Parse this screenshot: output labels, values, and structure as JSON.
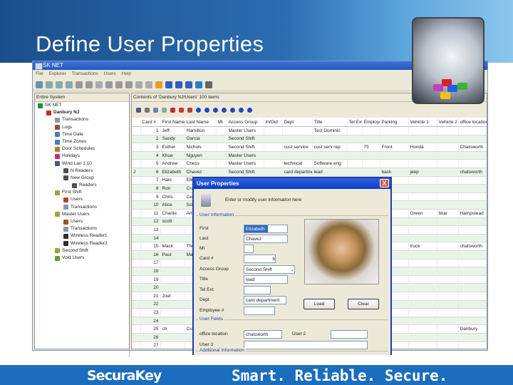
{
  "slide": {
    "title": "Define User Properties",
    "brand": "SecuraKey",
    "slogan": "Smart. Reliable. Secure."
  },
  "app": {
    "title": "SK NET",
    "menu": [
      "File",
      "Explorer",
      "Transactions",
      "Users",
      "Help"
    ],
    "left_header": "Entire System",
    "right_header": "Contents of 'Danbury NJ/Users' 100 items",
    "tree": [
      {
        "label": "SK NET",
        "level": 0,
        "color": "#2a8a3a"
      },
      {
        "label": "Danbury NJ",
        "level": 1,
        "color": "#c03020",
        "bold": true
      },
      {
        "label": "Transactions",
        "level": 2,
        "color": "#8899aa"
      },
      {
        "label": "Logs",
        "level": 2,
        "color": "#a05030"
      },
      {
        "label": "Time Date",
        "level": 2,
        "color": "#4a7ac0"
      },
      {
        "label": "Time Zones",
        "level": 2,
        "color": "#4a7ac0"
      },
      {
        "label": "Door Schedules",
        "level": 2,
        "color": "#b08030"
      },
      {
        "label": "Holidays",
        "level": 2,
        "color": "#c03070"
      },
      {
        "label": "Wind Lan 1.10",
        "level": 2,
        "color": "#406080"
      },
      {
        "label": "N Readers",
        "level": 3,
        "color": "#505050"
      },
      {
        "label": "New Group",
        "level": 3,
        "color": "#505050"
      },
      {
        "label": "Readers",
        "level": 4,
        "color": "#505050"
      },
      {
        "label": "First Shift",
        "level": 2,
        "color": "#a0a040"
      },
      {
        "label": "Users",
        "level": 3,
        "color": "#a05030"
      },
      {
        "label": "Transactions",
        "level": 3,
        "color": "#8899aa"
      },
      {
        "label": "Master Users",
        "level": 2,
        "color": "#a0a040"
      },
      {
        "label": "Users",
        "level": 3,
        "color": "#a05030"
      },
      {
        "label": "Transactions",
        "level": 3,
        "color": "#8899aa"
      },
      {
        "label": "Wireless Reader1",
        "level": 3,
        "color": "#303030"
      },
      {
        "label": "Wireless Reader2",
        "level": 3,
        "color": "#303030"
      },
      {
        "label": "Second Shift",
        "level": 2,
        "color": "#a0a040"
      },
      {
        "label": "Void Users",
        "level": 2,
        "color": "#60a040"
      }
    ],
    "columns": [
      "",
      "Card #",
      "First Name",
      "Last Name",
      "MI",
      "Access Group",
      "In/Out",
      "Dept",
      "Title",
      "Tel Ext",
      "Employee",
      "Parking",
      "Vehicle 1",
      "Vehicle 2",
      "office location"
    ],
    "rows": [
      [
        "",
        "1",
        "Jeff",
        "Hamilton",
        "",
        "Master Users",
        "",
        "",
        "Test Dominic",
        "",
        "",
        "",
        "",
        "",
        ""
      ],
      [
        "",
        "2",
        "Sandy",
        "Garcia",
        "",
        "Second Shift",
        "",
        "",
        "",
        "",
        "",
        "",
        "",
        "",
        ""
      ],
      [
        "",
        "3",
        "Esther",
        "Nichols",
        "",
        "Second Shift",
        "",
        "cust service",
        "cust serv rep",
        "",
        "75",
        "Front",
        "Honda",
        "",
        "Chatsworth"
      ],
      [
        "",
        "4",
        "Khue",
        "Nguyen",
        "",
        "Master Users",
        "",
        "",
        "",
        "",
        "",
        "",
        "",
        "",
        ""
      ],
      [
        "",
        "5",
        "Andrew",
        "Chess",
        "",
        "Master Users",
        "",
        "technical",
        "Software eng",
        "",
        "",
        "",
        "",
        "",
        ""
      ],
      [
        "J",
        "6",
        "Elizabeth",
        "Chavez",
        "",
        "Second Shift",
        "",
        "card department",
        "lead",
        "",
        "",
        "back",
        "jeep",
        "",
        "chatsworth"
      ],
      [
        "",
        "7",
        "Hani",
        "Elk",
        "",
        "",
        "",
        "",
        "",
        "",
        "",
        "",
        "",
        "",
        ""
      ],
      [
        "",
        "8",
        "Ron",
        "Cra",
        "",
        "",
        "",
        "",
        "",
        "",
        "",
        "",
        "",
        "",
        ""
      ],
      [
        "",
        "9",
        "Chris",
        "Cer",
        "",
        "",
        "",
        "",
        "",
        "",
        "",
        "",
        "",
        "",
        ""
      ],
      [
        "",
        "10",
        "Alice",
        "Sch",
        "",
        "",
        "",
        "",
        "",
        "",
        "",
        "",
        "",
        "",
        ""
      ],
      [
        "",
        "11",
        "Charlie",
        "Arth",
        "",
        "",
        "",
        "",
        "",
        "",
        "",
        "",
        "Green",
        "blue",
        "Hampstead"
      ],
      [
        "",
        "12",
        "scott",
        "",
        "",
        "",
        "",
        "",
        "",
        "",
        "",
        "",
        "",
        "",
        ""
      ],
      [
        "",
        "13",
        "",
        "",
        "",
        "",
        "",
        "",
        "",
        "",
        "",
        "",
        "",
        "",
        ""
      ],
      [
        "",
        "14",
        "",
        "",
        "",
        "",
        "",
        "",
        "",
        "",
        "",
        "",
        "",
        "",
        ""
      ],
      [
        "",
        "15",
        "Mack",
        "The",
        "",
        "",
        "",
        "",
        "",
        "",
        "",
        "back",
        "truck",
        "",
        "chatsworth"
      ],
      [
        "",
        "16",
        "Paul",
        "Ma",
        "",
        "",
        "",
        "",
        "",
        "",
        "",
        "",
        "",
        "",
        ""
      ],
      [
        "",
        "17",
        "",
        "",
        "",
        "",
        "",
        "",
        "",
        "",
        "",
        "",
        "",
        "",
        ""
      ],
      [
        "",
        "18",
        "",
        "",
        "",
        "",
        "",
        "",
        "",
        "",
        "",
        "",
        "",
        "",
        ""
      ],
      [
        "",
        "19",
        "",
        "",
        "",
        "",
        "",
        "",
        "",
        "",
        "",
        "",
        "",
        "",
        ""
      ],
      [
        "",
        "20",
        "",
        "",
        "",
        "",
        "",
        "",
        "",
        "",
        "",
        "",
        "",
        "",
        ""
      ],
      [
        "",
        "21",
        "Joel",
        "",
        "",
        "",
        "",
        "",
        "",
        "",
        "",
        "",
        "",
        "",
        ""
      ],
      [
        "",
        "22",
        "",
        "",
        "",
        "",
        "",
        "",
        "",
        "",
        "",
        "",
        "",
        "",
        ""
      ],
      [
        "",
        "23",
        "",
        "",
        "",
        "",
        "",
        "",
        "",
        "",
        "",
        "",
        "",
        "",
        ""
      ],
      [
        "",
        "24",
        "",
        "",
        "",
        "",
        "",
        "",
        "",
        "",
        "",
        "",
        "",
        "",
        ""
      ],
      [
        "",
        "25",
        "ch",
        "Cup",
        "",
        "",
        "",
        "",
        "",
        "",
        "",
        "",
        "",
        "",
        "Danbury"
      ],
      [
        "",
        "26",
        "",
        "",
        "",
        "",
        "",
        "",
        "",
        "",
        "",
        "",
        "",
        "",
        ""
      ],
      [
        "",
        "27",
        "",
        "",
        "",
        "",
        "",
        "",
        "",
        "",
        "",
        "",
        "",
        "",
        ""
      ]
    ]
  },
  "dialog": {
    "title": "User Properties",
    "close": "X",
    "intro": "Enter or modify user information here",
    "group_info": "User Information",
    "group_fields": "User Fields",
    "group_more": "Additional Information",
    "labels": {
      "first": "First",
      "last": "Last",
      "mi": "MI",
      "card": "Card #",
      "access": "Access Group",
      "title": "Title",
      "ext": "Tel Ext",
      "dept": "Dept",
      "employee": "Employee #",
      "office": "office location",
      "user2": "User 2",
      "user3": "User 3"
    },
    "values": {
      "first": "Elizabeth",
      "last": "Chavez",
      "mi": "",
      "card": "6",
      "access": "Second Shift",
      "title": "lead",
      "ext": "",
      "dept": "card department",
      "employee": "",
      "office": "chatsworth",
      "user2": "",
      "user3": ""
    },
    "load": "Load",
    "clear": "Clear"
  }
}
